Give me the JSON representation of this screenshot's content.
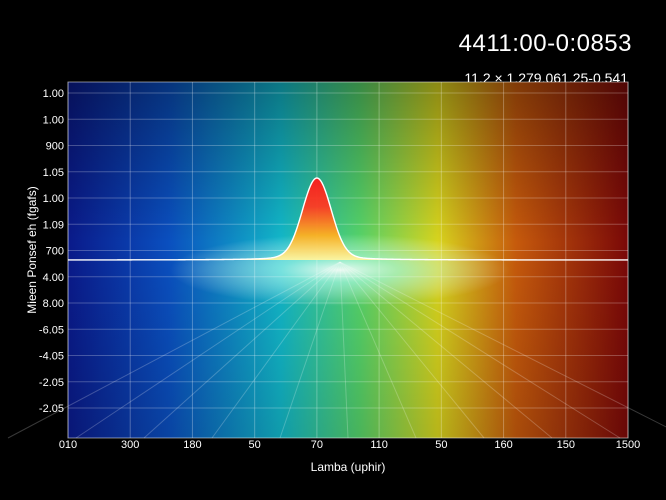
{
  "header": {
    "readout": "4411:00-0:0853",
    "subreadout": "11,2 × 1,279,061,25-0,541"
  },
  "chart_data": {
    "type": "line",
    "xlabel": "Lamba (uphir)",
    "ylabel": "Mieen Ponsef eh (fgafs)",
    "x_tick_labels": [
      "010",
      "300",
      "180",
      "50",
      "70",
      "110",
      "50",
      "160",
      "150",
      "1500"
    ],
    "y_tick_labels": [
      "1.00",
      "1.00",
      "900",
      "1.05",
      "1.00",
      "1.09",
      "700",
      "4.00",
      "8.00",
      "-6.05",
      "-4.05",
      "-2.05",
      "-2.05"
    ],
    "grid": true,
    "background": "spectral gradient blue to red",
    "series": [
      {
        "color": "#ffffff",
        "x": [
          0,
          1,
          2,
          3,
          3.5,
          3.8,
          4.0,
          4.2,
          4.5,
          5,
          6,
          7,
          8,
          9
        ],
        "y": [
          0,
          0,
          0,
          0.01,
          0.05,
          0.35,
          1.0,
          0.35,
          0.05,
          0.01,
          0,
          0,
          0,
          0
        ]
      }
    ]
  }
}
